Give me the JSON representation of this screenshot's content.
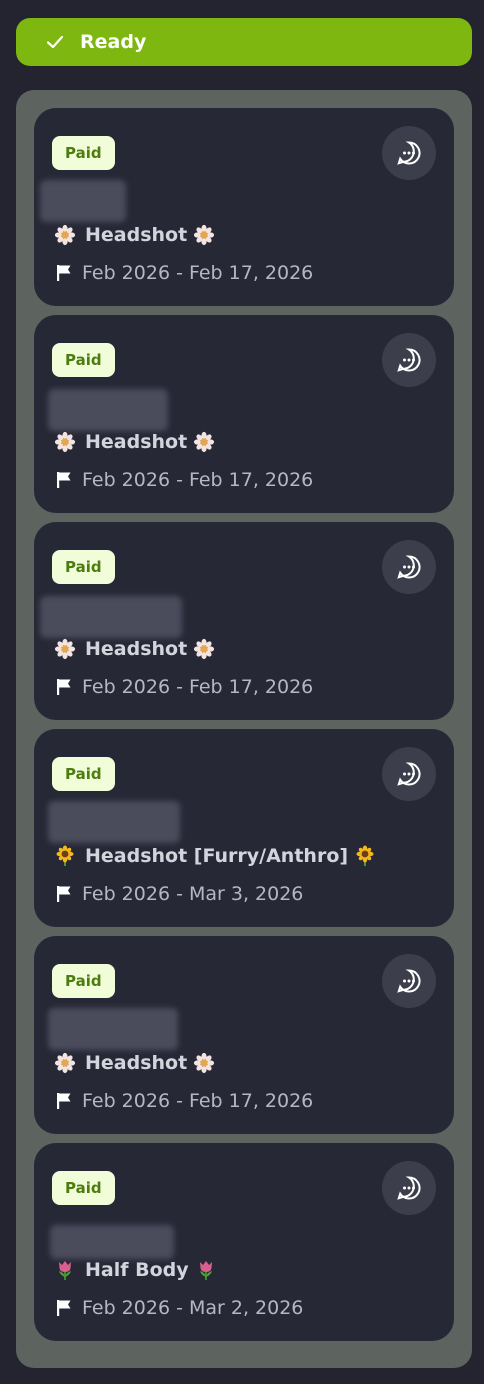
{
  "status": {
    "label": "Ready",
    "color": "#7db70f"
  },
  "cards": [
    {
      "badge": "Paid",
      "title": "Headshot",
      "emoji": "flower-white",
      "dates": "Feb 2026 - Feb 17, 2026"
    },
    {
      "badge": "Paid",
      "title": "Headshot",
      "emoji": "flower-white",
      "dates": "Feb 2026 - Feb 17, 2026"
    },
    {
      "badge": "Paid",
      "title": "Headshot",
      "emoji": "flower-white",
      "dates": "Feb 2026 - Feb 17, 2026"
    },
    {
      "badge": "Paid",
      "title": "Headshot [Furry/Anthro]",
      "emoji": "sunflower",
      "dates": "Feb 2026 - Mar 3, 2026"
    },
    {
      "badge": "Paid",
      "title": "Headshot",
      "emoji": "flower-white",
      "dates": "Feb 2026 - Feb 17, 2026"
    },
    {
      "badge": "Paid",
      "title": "Half Body",
      "emoji": "tulip",
      "dates": "Feb 2026 - Mar 2, 2026"
    }
  ]
}
